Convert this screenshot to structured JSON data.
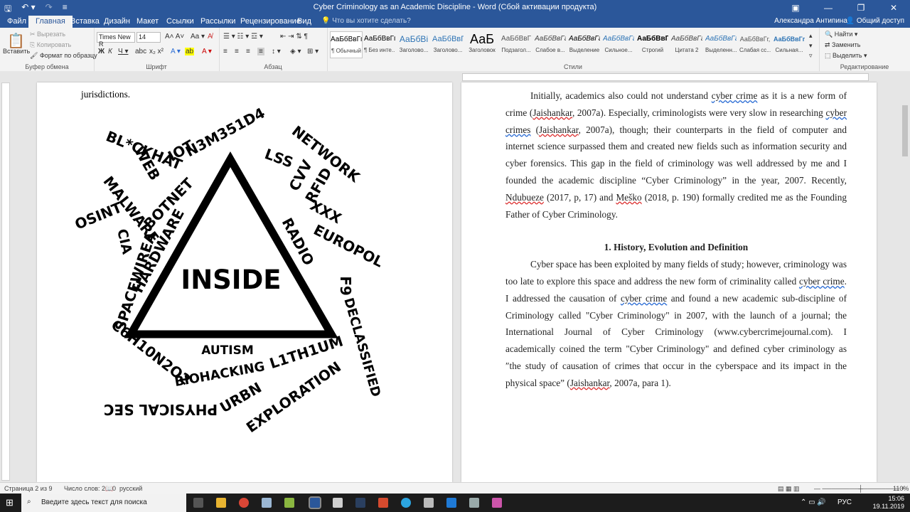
{
  "window": {
    "title": "Cyber Criminology as an Academic Discipline - Word (Сбой активации продукта)",
    "user": "Александра Антипина",
    "share": "Общий доступ"
  },
  "tabs": [
    "Файл",
    "Главная",
    "Вставка",
    "Дизайн",
    "Макет",
    "Ссылки",
    "Рассылки",
    "Рецензирование",
    "Вид"
  ],
  "tell_me": "Что вы хотите сделать?",
  "ribbon": {
    "clipboard": {
      "paste": "Вставить",
      "cut": "Вырезать",
      "copy": "Копировать",
      "format_painter": "Формат по образцу",
      "label": "Буфер обмена"
    },
    "font": {
      "name": "Times New R",
      "size": "14",
      "label": "Шрифт"
    },
    "paragraph": {
      "label": "Абзац"
    },
    "styles": {
      "label": "Стили",
      "items": [
        {
          "preview": "АаБбВвГг,",
          "name": "¶ Обычный"
        },
        {
          "preview": "АаБбВвГг,",
          "name": "¶ Без инте..."
        },
        {
          "preview": "АаБбВі",
          "name": "Заголово..."
        },
        {
          "preview": "АаБбВвГ",
          "name": "Заголово..."
        },
        {
          "preview": "АаБ",
          "name": "Заголовок"
        },
        {
          "preview": "АаБбВвГ",
          "name": "Подзагол..."
        },
        {
          "preview": "АаБбВвГг",
          "name": "Слабое в..."
        },
        {
          "preview": "АаБбВвГг",
          "name": "Выделение"
        },
        {
          "preview": "АаБбВвГг",
          "name": "Сильное..."
        },
        {
          "preview": "АаБбВвГг,",
          "name": "Строгий"
        },
        {
          "preview": "АаБбВвГг",
          "name": "Цитата 2"
        },
        {
          "preview": "АаБбВвГг",
          "name": "Выделенн..."
        },
        {
          "preview": "АаБбВвГг,",
          "name": "Слабая сс..."
        },
        {
          "preview": "АаБбВвГг,",
          "name": "Сильная..."
        }
      ]
    },
    "editing": {
      "find": "Найти",
      "replace": "Заменить",
      "select": "Выделить",
      "label": "Редактирование"
    }
  },
  "page1": {
    "top_text": "jurisdictions.",
    "figure_words": [
      "BL*CKHAT",
      "IOT",
      "N3M351D4",
      "NETWORK",
      "LSS",
      "CVV",
      "RFID",
      "XXX",
      "EUROPOL",
      "RADIO",
      "F9",
      "DECLASSIFIED",
      "L1TH1UM",
      "EXPLORATION",
      "URBN",
      "BIOHACKING",
      "AUTISM",
      "PHYSICAL SEC",
      "C6H10N2O2",
      "SPACEWIREA",
      "CIA",
      "OSINT",
      "MALWARE",
      "WEB",
      "BOTNET",
      "HARDWARE",
      "INSIDE"
    ]
  },
  "page2": {
    "p1": [
      "Initially, academics also could not understand ",
      "cyber crime",
      " as it is a new form of crime (",
      "Jaishankar",
      ", 2007a). Especially, criminologists were very slow in researching ",
      "cyber crimes",
      " (",
      "Jaishankar",
      ", 2007a), though; their counterparts in the field of computer and internet science surpassed them and created new fields such as information security and cyber forensics. This gap in the field of criminology was well addressed by me and I founded the academic discipline “Cyber Criminology” in the year, 2007. Recently, ",
      "Ndubueze",
      " (2017, p, 17) and ",
      "Meško",
      " (2018, p. 190) formally credited me as the Founding Father of Cyber Criminology."
    ],
    "heading": "1. History, Evolution and Definition",
    "p2": [
      "Cyber space has been exploited by many fields of study; however, criminology was too late to explore this space and address the new form of criminality called ",
      "cyber crime",
      ". I addressed the causation of ",
      "cyber crime",
      " and found a new academic sub-discipline of Criminology called \"Cyber Criminology\" in 2007, with the launch of a journal; the International Journal of Cyber Criminology (www.cybercrimejournal.com). I academically coined the term \"Cyber Criminology\" and defined cyber criminology as ″the study of causation of crimes that occur in the cyberspace and its impact in the physical space” (",
      "Jaishankar",
      ", 2007a, para 1)."
    ]
  },
  "status": {
    "page": "Страница 2 из 9",
    "words": "Число слов: 2600",
    "lang": "русский",
    "zoom": "110%"
  },
  "taskbar": {
    "search": "Введите здесь текст для поиска",
    "lang": "РУС",
    "time": "15:06",
    "date": "19.11.2019"
  }
}
